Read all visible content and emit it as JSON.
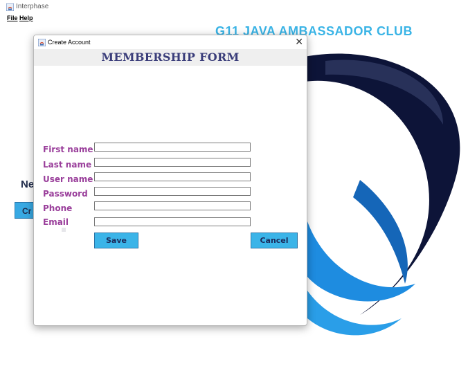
{
  "window": {
    "title": "Interphase"
  },
  "menu": {
    "file": "File",
    "help": "Help"
  },
  "background": {
    "club_title": "G11 JAVA AMBASSADOR CLUB",
    "partial_text": "Ne",
    "partial_button": "Cr"
  },
  "dialog": {
    "title": "Create Account",
    "form_title": "MEMBERSHIP FORM",
    "fields": [
      {
        "label": "First name",
        "value": ""
      },
      {
        "label": "Last name",
        "value": ""
      },
      {
        "label": "User name",
        "value": ""
      },
      {
        "label": "Password",
        "value": ""
      },
      {
        "label": "Phone",
        "value": ""
      },
      {
        "label": "Email",
        "value": ""
      }
    ],
    "save_label": "Save",
    "cancel_label": "Cancel",
    "close_glyph": "✕"
  },
  "colors": {
    "label": "#9a3f9b",
    "button": "#3bb4e8",
    "form_title": "#3a3d7a",
    "club_title": "#3ab4e6",
    "logo_dark": "#0d1438",
    "logo_blue": "#1e8ce0"
  }
}
